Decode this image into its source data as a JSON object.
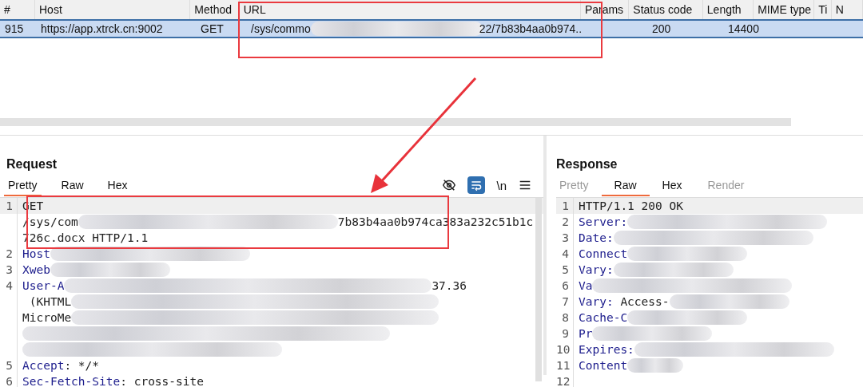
{
  "table": {
    "columns": [
      "#",
      "Host",
      "Method",
      "URL",
      "Params",
      "Status code",
      "Length",
      "MIME type",
      "Ti",
      "N"
    ],
    "rows": [
      {
        "selected": true,
        "number": "915",
        "host": "https://app.xtrck.cn:9002",
        "method": "GET",
        "url_start": "/sys/commo",
        "url_end": "22/7b83b4aa0b974..",
        "params": "",
        "status": "200",
        "length": "14400"
      }
    ]
  },
  "request": {
    "title": "Request",
    "tabs": [
      {
        "label": "Pretty",
        "selected": true,
        "disabled": false
      },
      {
        "label": "Raw",
        "selected": false,
        "disabled": false
      },
      {
        "label": "Hex",
        "selected": false,
        "disabled": false
      }
    ],
    "toolbar": {
      "wrap_on": true,
      "newline_label": "\\n"
    },
    "lines": [
      {
        "number": "1",
        "highlighted": true,
        "parts": [
          {
            "kind": "plain",
            "text": "GET"
          }
        ]
      },
      {
        "highlighted": false,
        "parts": [
          {
            "kind": "plain",
            "text": "/sys/com"
          },
          {
            "kind": "blur-wide"
          },
          {
            "kind": "plain",
            "text": "7b83b4aa0b974ca383a232c51b1c"
          }
        ]
      },
      {
        "highlighted": false,
        "parts": [
          {
            "kind": "plain",
            "text": "726c.docx HTTP/1.1"
          }
        ]
      },
      {
        "number": "2",
        "highlighted": false,
        "parts": [
          {
            "kind": "key",
            "text": "Host"
          },
          {
            "kind": "blur-long"
          }
        ]
      },
      {
        "number": "3",
        "highlighted": false,
        "parts": [
          {
            "kind": "key",
            "text": "Xweb"
          },
          {
            "kind": "blur-medium"
          }
        ]
      },
      {
        "number": "4",
        "highlighted": false,
        "parts": [
          {
            "kind": "key",
            "text": "User-A"
          },
          {
            "kind": "blur-full"
          },
          {
            "kind": "plain",
            "text": "37.36"
          }
        ]
      },
      {
        "highlighted": false,
        "parts": [
          {
            "kind": "plain",
            "text": " (KHTML"
          },
          {
            "kind": "blur-full"
          }
        ]
      },
      {
        "highlighted": false,
        "parts": [
          {
            "kind": "plain",
            "text": "MicroMe"
          },
          {
            "kind": "blur-full"
          }
        ]
      },
      {
        "highlighted": false,
        "parts": [
          {
            "kind": "blur-full"
          }
        ]
      },
      {
        "highlighted": false,
        "parts": [
          {
            "kind": "blur-wide"
          }
        ]
      },
      {
        "number": "5",
        "highlighted": false,
        "parts": [
          {
            "kind": "key",
            "text": "Accept"
          },
          {
            "kind": "plain",
            "text": ": */*"
          }
        ]
      },
      {
        "number": "6",
        "highlighted": false,
        "parts": [
          {
            "kind": "key",
            "text": "Sec-Fetch-Site"
          },
          {
            "kind": "plain",
            "text": ": cross-site"
          }
        ]
      }
    ]
  },
  "response": {
    "title": "Response",
    "tabs": [
      {
        "label": "Pretty",
        "selected": false,
        "disabled": true
      },
      {
        "label": "Raw",
        "selected": true,
        "disabled": false
      },
      {
        "label": "Hex",
        "selected": false,
        "disabled": false
      },
      {
        "label": "Render",
        "selected": false,
        "disabled": true
      }
    ],
    "lines": [
      {
        "number": "1",
        "highlighted": true,
        "parts": [
          {
            "kind": "plain",
            "text": "HTTP/1.1 200 OK"
          }
        ]
      },
      {
        "number": "2",
        "highlighted": false,
        "parts": [
          {
            "kind": "key",
            "text": "Server:"
          },
          {
            "kind": "blur-long"
          }
        ]
      },
      {
        "number": "3",
        "highlighted": false,
        "parts": [
          {
            "kind": "key",
            "text": "Date:"
          },
          {
            "kind": "blur-long"
          }
        ]
      },
      {
        "number": "4",
        "highlighted": false,
        "parts": [
          {
            "kind": "key",
            "text": "Connect"
          },
          {
            "kind": "blur-medium"
          }
        ]
      },
      {
        "number": "5",
        "highlighted": false,
        "parts": [
          {
            "kind": "key",
            "text": "Vary:"
          },
          {
            "kind": "blur-medium"
          }
        ]
      },
      {
        "number": "6",
        "highlighted": false,
        "parts": [
          {
            "kind": "key",
            "text": "Va"
          },
          {
            "kind": "blur-long"
          }
        ]
      },
      {
        "number": "7",
        "highlighted": false,
        "parts": [
          {
            "kind": "key",
            "text": "Vary:"
          },
          {
            "kind": "plain",
            "text": " Access-"
          },
          {
            "kind": "blur-medium"
          }
        ]
      },
      {
        "number": "8",
        "highlighted": false,
        "parts": [
          {
            "kind": "key",
            "text": "Cache-C"
          },
          {
            "kind": "blur-medium"
          }
        ]
      },
      {
        "number": "9",
        "highlighted": false,
        "parts": [
          {
            "kind": "key",
            "text": "Pr"
          },
          {
            "kind": "blur-medium"
          }
        ]
      },
      {
        "number": "10",
        "highlighted": false,
        "parts": [
          {
            "kind": "key",
            "text": "Expires:"
          },
          {
            "kind": "blur-long"
          }
        ]
      },
      {
        "number": "11",
        "highlighted": false,
        "parts": [
          {
            "kind": "key",
            "text": "Content"
          },
          {
            "kind": "blur-short"
          }
        ]
      },
      {
        "number": "12",
        "highlighted": false
      }
    ]
  }
}
